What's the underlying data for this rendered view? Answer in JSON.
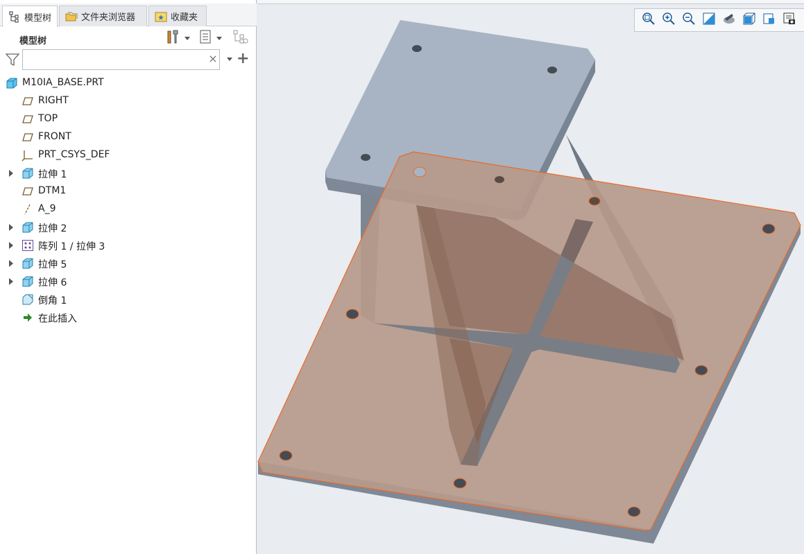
{
  "tabs": [
    {
      "label": "模型树",
      "icon": "model-tree-icon",
      "active": true
    },
    {
      "label": "文件夹浏览器",
      "icon": "folder-browser-icon",
      "active": false
    },
    {
      "label": "收藏夹",
      "icon": "favorites-icon",
      "active": false
    }
  ],
  "panel": {
    "title": "模型树",
    "settings_icon": "tools-icon",
    "show_icon": "list-view-icon",
    "extra_icon": "tree-filter-icon"
  },
  "filter": {
    "placeholder": "",
    "value": "",
    "clear_label": "×",
    "add_label": "+"
  },
  "tree": {
    "root": {
      "label": "M10IA_BASE.PRT",
      "icon": "part-icon"
    },
    "items": [
      {
        "label": "RIGHT",
        "icon": "datum-plane-icon",
        "expandable": false
      },
      {
        "label": "TOP",
        "icon": "datum-plane-icon",
        "expandable": false
      },
      {
        "label": "FRONT",
        "icon": "datum-plane-icon",
        "expandable": false
      },
      {
        "label": "PRT_CSYS_DEF",
        "icon": "coordinate-system-icon",
        "expandable": false
      },
      {
        "label": "拉伸 1",
        "icon": "extrude-icon",
        "expandable": true
      },
      {
        "label": "DTM1",
        "icon": "datum-plane-icon",
        "expandable": false
      },
      {
        "label": "A_9",
        "icon": "datum-axis-icon",
        "expandable": false
      },
      {
        "label": "拉伸 2",
        "icon": "extrude-icon",
        "expandable": true
      },
      {
        "label": "阵列 1 / 拉伸 3",
        "icon": "pattern-icon",
        "expandable": true
      },
      {
        "label": "拉伸 5",
        "icon": "extrude-icon",
        "expandable": true
      },
      {
        "label": "拉伸 6",
        "icon": "extrude-icon",
        "expandable": true
      },
      {
        "label": "倒角 1",
        "icon": "chamfer-icon",
        "expandable": false
      },
      {
        "label": "在此插入",
        "icon": "insert-here-arrow-icon",
        "expandable": false
      }
    ]
  },
  "view_toolbar": [
    "refit-icon",
    "zoom-in-icon",
    "zoom-out-icon",
    "repaint-icon",
    "view-manager-icon",
    "display-style-icon",
    "saved-views-icon",
    "annotation-display-icon"
  ],
  "colors": {
    "base_plate": "#b49a8c",
    "selection_edge": "#e86a2a",
    "top_plate": "#a8b4c2",
    "side_shade": "#7a8492"
  }
}
